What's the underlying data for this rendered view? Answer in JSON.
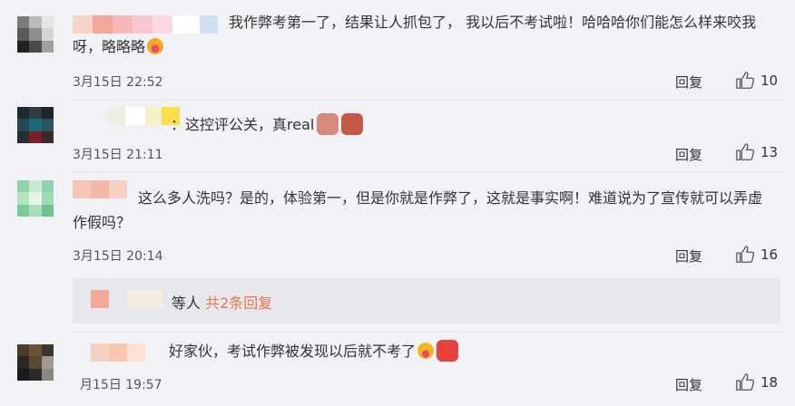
{
  "comments": [
    {
      "text": "我作弊考第一了，结果让人抓包了， 我以后不考试啦！哈哈哈你们能怎么样来咬我呀，略略略",
      "time": "3月15日 22:52",
      "reply_label": "回复",
      "likes": "10",
      "emoji": "tongue-face-emoji"
    },
    {
      "text": "：这控评公关，真real",
      "time": "3月15日 21:11",
      "reply_label": "回复",
      "likes": "13",
      "emoji": "sticker-emoji"
    },
    {
      "text": "这么多人洗吗？是的，体验第一，但是你就是作弊了，这就是事实啊！难道说为了宣传就可以弄虚作假吗？",
      "time": "3月15日 20:14",
      "reply_label": "回复",
      "likes": "16"
    },
    {
      "text": "好家伙，考试作弊被发现以后就不考了",
      "time": "月15日 19:57",
      "reply_label": "回复",
      "likes": "18",
      "emoji": "laugh-emoji"
    }
  ],
  "sub_replies": {
    "prefix": "等人 ",
    "more_label": "共2条回复"
  },
  "colors": {
    "accent": "#eb7350",
    "background": "#f1f2f5"
  }
}
